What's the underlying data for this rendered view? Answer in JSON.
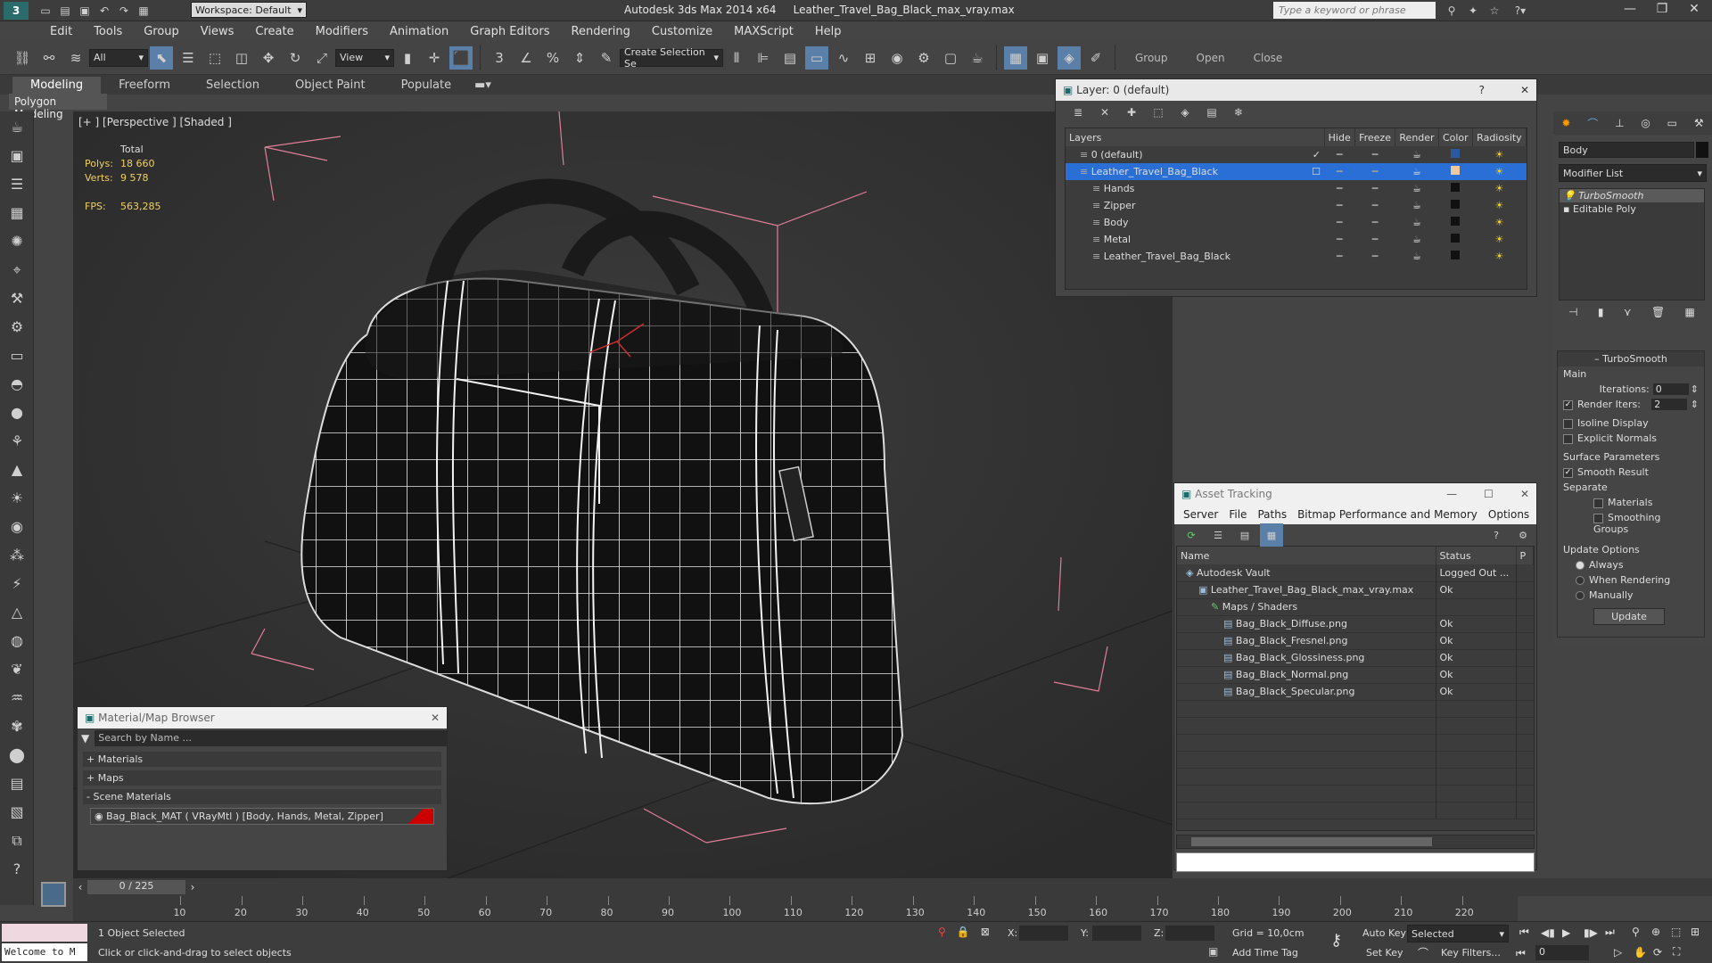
{
  "titlebar": {
    "app_title": "Autodesk 3ds Max  2014 x64",
    "file_name": "Leather_Travel_Bag_Black_max_vray.max",
    "workspace": "Workspace: Default",
    "search_placeholder": "Type a keyword or phrase"
  },
  "menu": [
    "Edit",
    "Tools",
    "Group",
    "Views",
    "Create",
    "Modifiers",
    "Animation",
    "Graph Editors",
    "Rendering",
    "Customize",
    "MAXScript",
    "Help"
  ],
  "toolbar": {
    "filter": "All",
    "ref_coord": "View",
    "sel_set": "Create Selection Se",
    "group_label": "Group",
    "open_label": "Open",
    "close_label": "Close"
  },
  "ribbon": {
    "tabs": [
      "Modeling",
      "Freeform",
      "Selection",
      "Object Paint",
      "Populate"
    ],
    "panel_label": "Polygon Modeling"
  },
  "viewport": {
    "label": "[+ ] [Perspective ] [Shaded ]",
    "total_label": "Total",
    "polys_label": "Polys:",
    "polys_value": "18 660",
    "verts_label": "Verts:",
    "verts_value": "9 578",
    "fps_label": "FPS:",
    "fps_value": "563,285"
  },
  "layer_window": {
    "title": "Layer: 0 (default)",
    "columns": [
      "Layers",
      "Hide",
      "Freeze",
      "Render",
      "Color",
      "Radiosity"
    ],
    "rows": [
      {
        "name": "0 (default)",
        "color": "#2c5aa0",
        "indent": 0,
        "selected": false,
        "active": true
      },
      {
        "name": "Leather_Travel_Bag_Black",
        "color": "#f0c8a0",
        "indent": 0,
        "selected": true,
        "active": false
      },
      {
        "name": "Hands",
        "color": "#111111",
        "indent": 1,
        "selected": false,
        "active": false
      },
      {
        "name": "Zipper",
        "color": "#111111",
        "indent": 1,
        "selected": false,
        "active": false
      },
      {
        "name": "Body",
        "color": "#111111",
        "indent": 1,
        "selected": false,
        "active": false
      },
      {
        "name": "Metal",
        "color": "#111111",
        "indent": 1,
        "selected": false,
        "active": false
      },
      {
        "name": "Leather_Travel_Bag_Black",
        "color": "#111111",
        "indent": 1,
        "selected": false,
        "active": false
      }
    ]
  },
  "command_panel": {
    "object_name": "Body",
    "modifier_list": "Modifier List",
    "stack": [
      "TurboSmooth",
      "Editable Poly"
    ],
    "rollout_title": "TurboSmooth",
    "main_label": "Main",
    "iterations_label": "Iterations:",
    "iterations_value": "0",
    "render_iters_label": "Render Iters:",
    "render_iters_value": "2",
    "isoline": "Isoline Display",
    "explicit": "Explicit Normals",
    "surface_params": "Surface Parameters",
    "smooth_result": "Smooth Result",
    "separate": "Separate",
    "materials": "Materials",
    "smoothing_groups": "Smoothing Groups",
    "update_options": "Update Options",
    "always": "Always",
    "when_rendering": "When Rendering",
    "manually": "Manually",
    "update_btn": "Update"
  },
  "asset_window": {
    "title": "Asset Tracking",
    "menu": [
      "Server",
      "File",
      "Paths",
      "Bitmap Performance and Memory",
      "Options"
    ],
    "columns": [
      "Name",
      "Status",
      "P"
    ],
    "rows": [
      {
        "name": "Autodesk Vault",
        "status": "Logged Out ...",
        "indent": 0
      },
      {
        "name": "Leather_Travel_Bag_Black_max_vray.max",
        "status": "Ok",
        "indent": 1
      },
      {
        "name": "Maps / Shaders",
        "status": "",
        "indent": 2
      },
      {
        "name": "Bag_Black_Diffuse.png",
        "status": "Ok",
        "indent": 3
      },
      {
        "name": "Bag_Black_Fresnel.png",
        "status": "Ok",
        "indent": 3
      },
      {
        "name": "Bag_Black_Glossiness.png",
        "status": "Ok",
        "indent": 3
      },
      {
        "name": "Bag_Black_Normal.png",
        "status": "Ok",
        "indent": 3
      },
      {
        "name": "Bag_Black_Specular.png",
        "status": "Ok",
        "indent": 3
      }
    ]
  },
  "material_browser": {
    "title": "Material/Map Browser",
    "search_placeholder": "Search by Name ...",
    "materials": "+ Materials",
    "maps": "+ Maps",
    "scene_materials": "- Scene Materials",
    "item": "Bag_Black_MAT  ( VRayMtl )  [Body, Hands, Metal, Zipper]"
  },
  "timeline": {
    "frame": "0 / 225",
    "ticks": [
      "10",
      "20",
      "30",
      "40",
      "50",
      "60",
      "70",
      "80",
      "90",
      "100",
      "110",
      "120",
      "130",
      "140",
      "150",
      "160",
      "170",
      "180",
      "190",
      "200",
      "210",
      "220"
    ]
  },
  "status": {
    "welcome": "Welcome to M",
    "selected": "1 Object Selected",
    "hint": "Click or click-and-drag to select objects",
    "x_label": "X:",
    "y_label": "Y:",
    "z_label": "Z:",
    "grid": "Grid = 10,0cm",
    "add_time_tag": "Add Time Tag",
    "auto_key": "Auto Key",
    "set_key": "Set Key",
    "key_selected": "Selected",
    "key_filters": "Key Filters...",
    "frame_field": "0"
  }
}
